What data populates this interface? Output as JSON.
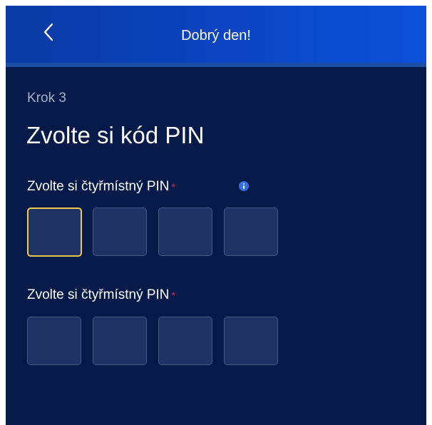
{
  "header": {
    "title": "Dobrý den!",
    "back_icon": "chevron-left-icon"
  },
  "step": {
    "label": "Krok 3"
  },
  "page": {
    "title": "Zvolte si kód PIN"
  },
  "pin_fields": [
    {
      "label": "Zvolte si čtyřmístný PIN",
      "required_mark": "*",
      "has_info_icon": true,
      "digits": [
        "",
        "",
        "",
        ""
      ],
      "focused_index": 0
    },
    {
      "label": "Zvolte si čtyřmístný PIN",
      "required_mark": "*",
      "has_info_icon": false,
      "digits": [
        "",
        "",
        "",
        ""
      ],
      "focused_index": null
    }
  ],
  "colors": {
    "background": "#061a4a",
    "header": "#0b45c4",
    "focus_border": "#f1c94b",
    "required": "#e0284d",
    "info": "#2f6fe0"
  }
}
